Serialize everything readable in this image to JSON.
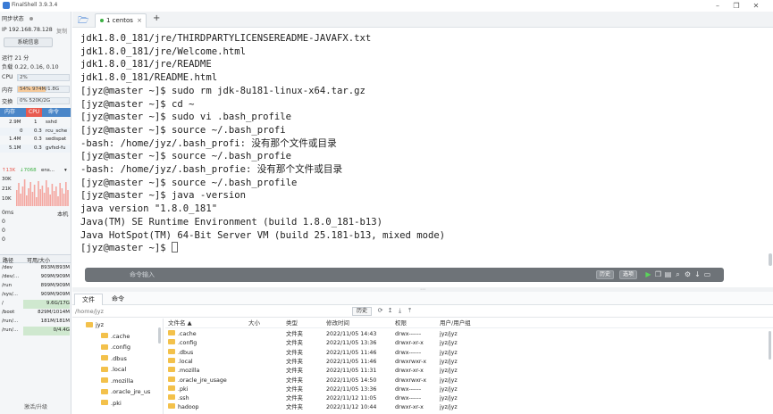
{
  "window": {
    "title": "FinalShell 3.9.3.4",
    "min": "–",
    "max": "❐",
    "close": "✕"
  },
  "sidebar": {
    "sync_status": "同步状态",
    "ip_line": "IP 192.168.78.128",
    "copy_label": "复制",
    "sysinfo_button": "系统信息",
    "uptime": "运行 21 分",
    "load": "负载 0.22, 0.16, 0.10",
    "cpu_label": "CPU",
    "cpu_value": "2%",
    "cpu_percent": 2,
    "mem_label": "内存",
    "mem_value": "54%  974M/1.8G",
    "mem_percent": 54,
    "swap_label": "交换",
    "swap_value": "0%        520K/2G",
    "swap_percent": 0,
    "proc_tabs": [
      "内存",
      "CPU",
      "命令"
    ],
    "processes": [
      {
        "mem": "2.9M",
        "cpu": "1",
        "cmd": "sshd"
      },
      {
        "mem": "0",
        "cpu": "0.3",
        "cmd": "rcu_sche"
      },
      {
        "mem": "1.4M",
        "cpu": "0.3",
        "cmd": "sedispat"
      },
      {
        "mem": "5.1M",
        "cpu": "0.3",
        "cmd": "gvfsd-fu"
      }
    ],
    "net_up": "↑13K",
    "net_down": "↓7068",
    "net_iface": "ens...",
    "chart_labels": [
      "30K",
      "21K",
      "10K"
    ],
    "latency": "0ms",
    "latency_host": "本机",
    "latency_values": [
      "0",
      "0",
      "0"
    ],
    "disk_header": {
      "path": "路径",
      "usage": "可用/大小"
    },
    "disks": [
      {
        "path": "/dev",
        "val": "893M/893M",
        "hl": false
      },
      {
        "path": "/dev/...",
        "val": "909M/909M",
        "hl": false
      },
      {
        "path": "/run",
        "val": "899M/909M",
        "hl": false
      },
      {
        "path": "/sys/...",
        "val": "909M/909M",
        "hl": false
      },
      {
        "path": "/",
        "val": "9.6G/17G",
        "hl": true
      },
      {
        "path": "/boot",
        "val": "829M/1014M",
        "hl": false
      },
      {
        "path": "/run/...",
        "val": "181M/181M",
        "hl": false
      },
      {
        "path": "/run/...",
        "val": "0/4.4G",
        "hl": true
      }
    ],
    "footer": "激活/升级"
  },
  "tabs": {
    "active": "1 centos",
    "add": "+"
  },
  "terminal": {
    "lines": [
      "jdk1.8.0_181/jre/THIRDPARTYLICENSEREADME-JAVAFX.txt",
      "jdk1.8.0_181/jre/Welcome.html",
      "jdk1.8.0_181/jre/README",
      "jdk1.8.0_181/README.html",
      "[jyz@master ~]$ sudo rm jdk-8u181-linux-x64.tar.gz",
      "[jyz@master ~]$ cd ~",
      "[jyz@master ~]$ sudo vi .bash_profile",
      "[jyz@master ~]$ source ~/.bash_profi",
      "-bash: /home/jyz/.bash_profi: 没有那个文件或目录",
      "[jyz@master ~]$ source ~/.bash_profie",
      "-bash: /home/jyz/.bash_profie: 没有那个文件或目录",
      "[jyz@master ~]$ source ~/.bash_profile",
      "[jyz@master ~]$ java -version",
      "java version \"1.8.0_181\"",
      "Java(TM) SE Runtime Environment (build 1.8.0_181-b13)",
      "Java HotSpot(TM) 64-Bit Server VM (build 25.181-b13, mixed mode)",
      "[jyz@master ~]$ "
    ]
  },
  "cmdbar": {
    "placeholder": "命令输入",
    "history": "历史",
    "options": "选项"
  },
  "bottom": {
    "tabs": [
      "文件",
      "命令"
    ],
    "path": "/home/jyz",
    "history_button": "历史",
    "tree": [
      {
        "label": "jyz",
        "indent": 0
      },
      {
        "label": ".cache",
        "indent": 1
      },
      {
        "label": ".config",
        "indent": 1
      },
      {
        "label": ".dbus",
        "indent": 1
      },
      {
        "label": ".local",
        "indent": 1
      },
      {
        "label": ".mozilla",
        "indent": 1
      },
      {
        "label": ".oracle_jre_us",
        "indent": 1
      },
      {
        "label": ".pki",
        "indent": 1
      }
    ],
    "columns": [
      "文件名 ▲",
      "大小",
      "类型",
      "修改时间",
      "权限",
      "用户/用户组"
    ],
    "files": [
      {
        "name": ".cache",
        "size": "",
        "type": "文件夹",
        "mtime": "2022/11/05 14:43",
        "perm": "drwx------",
        "owner": "jyz/jyz"
      },
      {
        "name": ".config",
        "size": "",
        "type": "文件夹",
        "mtime": "2022/11/05 13:36",
        "perm": "drwxr-xr-x",
        "owner": "jyz/jyz"
      },
      {
        "name": ".dbus",
        "size": "",
        "type": "文件夹",
        "mtime": "2022/11/05 11:46",
        "perm": "drwx------",
        "owner": "jyz/jyz"
      },
      {
        "name": ".local",
        "size": "",
        "type": "文件夹",
        "mtime": "2022/11/05 11:46",
        "perm": "drwxrwxr-x",
        "owner": "jyz/jyz"
      },
      {
        "name": ".mozilla",
        "size": "",
        "type": "文件夹",
        "mtime": "2022/11/05 11:31",
        "perm": "drwxr-xr-x",
        "owner": "jyz/jyz"
      },
      {
        "name": ".oracle_jre_usage",
        "size": "",
        "type": "文件夹",
        "mtime": "2022/11/05 14:50",
        "perm": "drwxrwxr-x",
        "owner": "jyz/jyz"
      },
      {
        "name": ".pki",
        "size": "",
        "type": "文件夹",
        "mtime": "2022/11/05 13:36",
        "perm": "drwx------",
        "owner": "jyz/jyz"
      },
      {
        "name": ".ssh",
        "size": "",
        "type": "文件夹",
        "mtime": "2022/11/12 11:05",
        "perm": "drwx------",
        "owner": "jyz/jyz"
      },
      {
        "name": "hadoop",
        "size": "",
        "type": "文件夹",
        "mtime": "2022/11/12 10:44",
        "perm": "drwxr-xr-x",
        "owner": "jyz/jyz"
      }
    ]
  },
  "colors": {
    "accent": "#4a86c8",
    "cpu_tab": "#e85a4f",
    "chart": "#f4a6a0",
    "folder": "#f3c14b",
    "status_green": "#3cb043"
  }
}
